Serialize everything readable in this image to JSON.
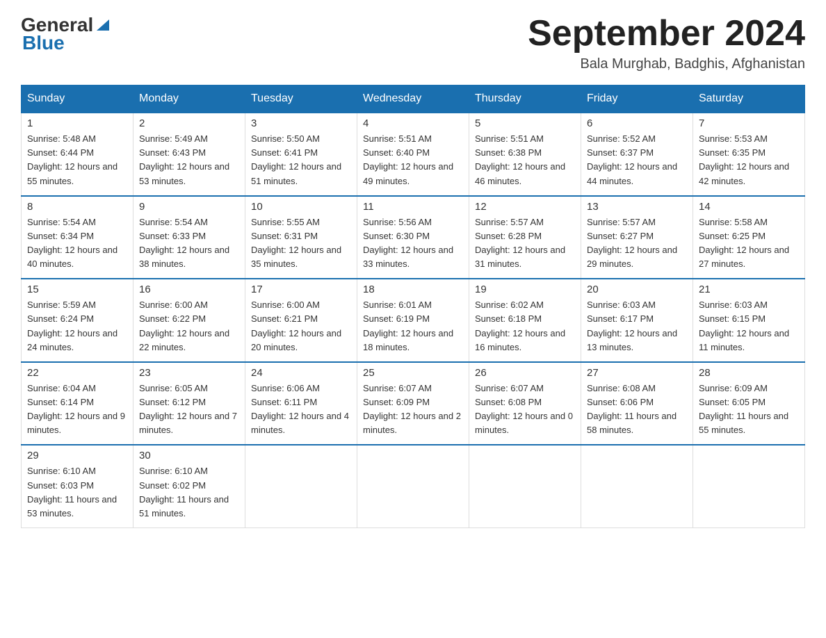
{
  "header": {
    "logo_general": "General",
    "logo_blue": "Blue",
    "month_title": "September 2024",
    "location": "Bala Murghab, Badghis, Afghanistan"
  },
  "days_of_week": [
    "Sunday",
    "Monday",
    "Tuesday",
    "Wednesday",
    "Thursday",
    "Friday",
    "Saturday"
  ],
  "weeks": [
    [
      {
        "day": "1",
        "sunrise": "5:48 AM",
        "sunset": "6:44 PM",
        "daylight": "12 hours and 55 minutes."
      },
      {
        "day": "2",
        "sunrise": "5:49 AM",
        "sunset": "6:43 PM",
        "daylight": "12 hours and 53 minutes."
      },
      {
        "day": "3",
        "sunrise": "5:50 AM",
        "sunset": "6:41 PM",
        "daylight": "12 hours and 51 minutes."
      },
      {
        "day": "4",
        "sunrise": "5:51 AM",
        "sunset": "6:40 PM",
        "daylight": "12 hours and 49 minutes."
      },
      {
        "day": "5",
        "sunrise": "5:51 AM",
        "sunset": "6:38 PM",
        "daylight": "12 hours and 46 minutes."
      },
      {
        "day": "6",
        "sunrise": "5:52 AM",
        "sunset": "6:37 PM",
        "daylight": "12 hours and 44 minutes."
      },
      {
        "day": "7",
        "sunrise": "5:53 AM",
        "sunset": "6:35 PM",
        "daylight": "12 hours and 42 minutes."
      }
    ],
    [
      {
        "day": "8",
        "sunrise": "5:54 AM",
        "sunset": "6:34 PM",
        "daylight": "12 hours and 40 minutes."
      },
      {
        "day": "9",
        "sunrise": "5:54 AM",
        "sunset": "6:33 PM",
        "daylight": "12 hours and 38 minutes."
      },
      {
        "day": "10",
        "sunrise": "5:55 AM",
        "sunset": "6:31 PM",
        "daylight": "12 hours and 35 minutes."
      },
      {
        "day": "11",
        "sunrise": "5:56 AM",
        "sunset": "6:30 PM",
        "daylight": "12 hours and 33 minutes."
      },
      {
        "day": "12",
        "sunrise": "5:57 AM",
        "sunset": "6:28 PM",
        "daylight": "12 hours and 31 minutes."
      },
      {
        "day": "13",
        "sunrise": "5:57 AM",
        "sunset": "6:27 PM",
        "daylight": "12 hours and 29 minutes."
      },
      {
        "day": "14",
        "sunrise": "5:58 AM",
        "sunset": "6:25 PM",
        "daylight": "12 hours and 27 minutes."
      }
    ],
    [
      {
        "day": "15",
        "sunrise": "5:59 AM",
        "sunset": "6:24 PM",
        "daylight": "12 hours and 24 minutes."
      },
      {
        "day": "16",
        "sunrise": "6:00 AM",
        "sunset": "6:22 PM",
        "daylight": "12 hours and 22 minutes."
      },
      {
        "day": "17",
        "sunrise": "6:00 AM",
        "sunset": "6:21 PM",
        "daylight": "12 hours and 20 minutes."
      },
      {
        "day": "18",
        "sunrise": "6:01 AM",
        "sunset": "6:19 PM",
        "daylight": "12 hours and 18 minutes."
      },
      {
        "day": "19",
        "sunrise": "6:02 AM",
        "sunset": "6:18 PM",
        "daylight": "12 hours and 16 minutes."
      },
      {
        "day": "20",
        "sunrise": "6:03 AM",
        "sunset": "6:17 PM",
        "daylight": "12 hours and 13 minutes."
      },
      {
        "day": "21",
        "sunrise": "6:03 AM",
        "sunset": "6:15 PM",
        "daylight": "12 hours and 11 minutes."
      }
    ],
    [
      {
        "day": "22",
        "sunrise": "6:04 AM",
        "sunset": "6:14 PM",
        "daylight": "12 hours and 9 minutes."
      },
      {
        "day": "23",
        "sunrise": "6:05 AM",
        "sunset": "6:12 PM",
        "daylight": "12 hours and 7 minutes."
      },
      {
        "day": "24",
        "sunrise": "6:06 AM",
        "sunset": "6:11 PM",
        "daylight": "12 hours and 4 minutes."
      },
      {
        "day": "25",
        "sunrise": "6:07 AM",
        "sunset": "6:09 PM",
        "daylight": "12 hours and 2 minutes."
      },
      {
        "day": "26",
        "sunrise": "6:07 AM",
        "sunset": "6:08 PM",
        "daylight": "12 hours and 0 minutes."
      },
      {
        "day": "27",
        "sunrise": "6:08 AM",
        "sunset": "6:06 PM",
        "daylight": "11 hours and 58 minutes."
      },
      {
        "day": "28",
        "sunrise": "6:09 AM",
        "sunset": "6:05 PM",
        "daylight": "11 hours and 55 minutes."
      }
    ],
    [
      {
        "day": "29",
        "sunrise": "6:10 AM",
        "sunset": "6:03 PM",
        "daylight": "11 hours and 53 minutes."
      },
      {
        "day": "30",
        "sunrise": "6:10 AM",
        "sunset": "6:02 PM",
        "daylight": "11 hours and 51 minutes."
      },
      null,
      null,
      null,
      null,
      null
    ]
  ]
}
